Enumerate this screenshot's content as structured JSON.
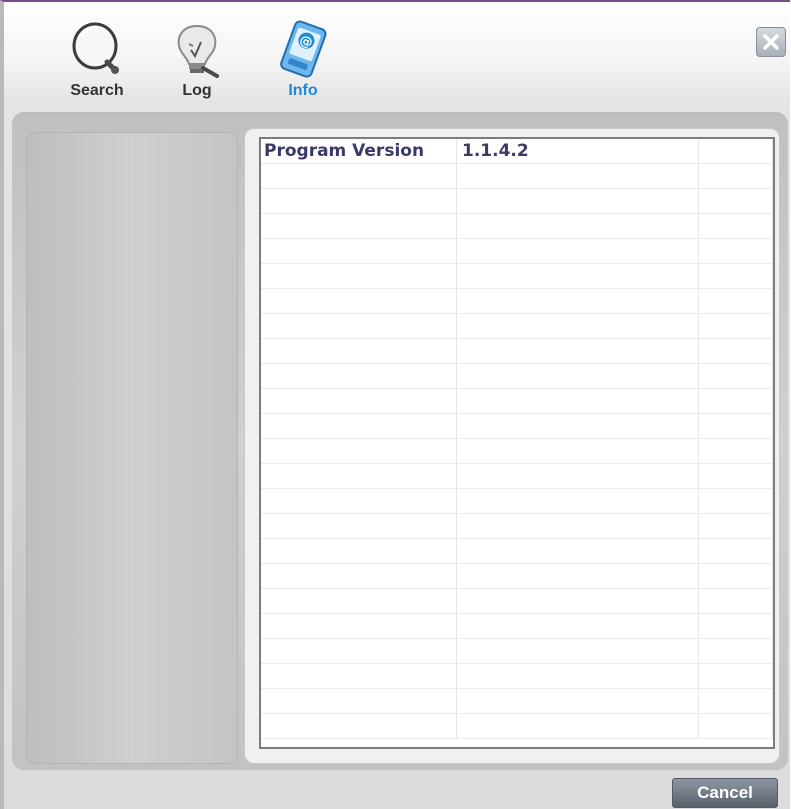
{
  "toolbar": {
    "search_label": "Search",
    "log_label": "Log",
    "info_label": "Info",
    "icons": [
      "search-icon",
      "lightbulb-icon",
      "info-device-icon"
    ],
    "active_tab": "Info",
    "active_color": "#1e8ad6",
    "inactive_color": "#333333"
  },
  "close": {
    "icon": "close-icon",
    "glyph": "✕"
  },
  "info_table": {
    "rows": [
      {
        "label": "Program Version",
        "value": "1.1.4.2"
      }
    ],
    "empty_row_count": 23
  },
  "footer": {
    "cancel_label": "Cancel"
  }
}
